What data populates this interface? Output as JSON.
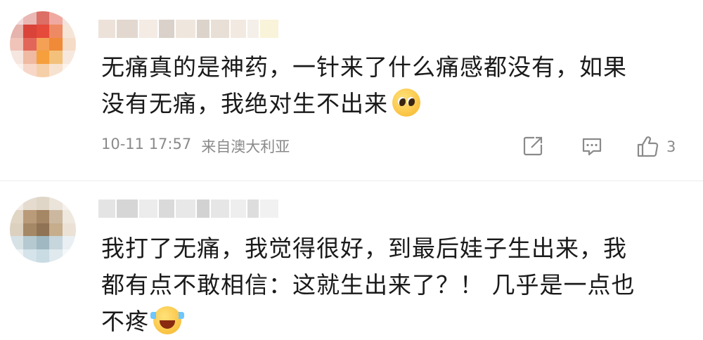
{
  "comments": [
    {
      "avatar_colors": [
        "#f4d9d9",
        "#e9b8b5",
        "#dc6e66",
        "#f0a9a0",
        "#f3e3dc",
        "#e7b3ad",
        "#d9433a",
        "#e64a3b",
        "#ee8a63",
        "#f6e5d7",
        "#f0c4b9",
        "#e3665a",
        "#f4a156",
        "#f08a38",
        "#f5dcc6",
        "#f5e6df",
        "#f0b9a2",
        "#f59f3d",
        "#f3c17a",
        "#f7e8de",
        "#fbf2ec",
        "#f6d7c8",
        "#f5cfa8",
        "#f7e2cf",
        "#fbf3ec"
      ],
      "username_colors": [
        "#ece2da",
        "#e2d8cf",
        "#f3ebe4",
        "#d9d1ca",
        "#efe6de",
        "#dcd3cb",
        "#e8dfd7",
        "#f2e9e1",
        "#f5efe9",
        "#f9f3d9"
      ],
      "text_lines": [
        "无痛真的是神药，一针来了什么痛感都没有，如果",
        "没有无痛，我绝对生不出来"
      ],
      "emoji": "pleading-face",
      "time": "10-11 17:57",
      "location": "来自澳大利亚",
      "like_count": "3"
    },
    {
      "avatar_colors": [
        "#f1ebe4",
        "#e5dccf",
        "#dfd6c7",
        "#ebe4da",
        "#f5f0ea",
        "#e1d5c4",
        "#b99b7a",
        "#a58665",
        "#cbb89f",
        "#efe8df",
        "#dcd0bf",
        "#a58866",
        "#8f7354",
        "#c6ad8c",
        "#ebe2d5",
        "#d7e2e6",
        "#b5c9d1",
        "#9fb8c2",
        "#c6d6dc",
        "#e9eff2",
        "#eef3f5",
        "#d5e3ea",
        "#c9dbe3",
        "#dfe9ee",
        "#f4f7f8"
      ],
      "username_colors": [
        "#e4e4e4",
        "#d6d6d6",
        "#ececec",
        "#dadada",
        "#e8e8e8",
        "#d2d2d2",
        "#e6e6e6",
        "#eeeeee",
        "#dddddd",
        "#f1f1f1"
      ],
      "text_lines": [
        "我打了无痛，我觉得很好，到最后娃子生出来，我",
        "都有点不敢相信：这就生出来了？！ 几乎是一点也",
        "不疼"
      ],
      "emoji": "laughing-crying-face"
    }
  ]
}
